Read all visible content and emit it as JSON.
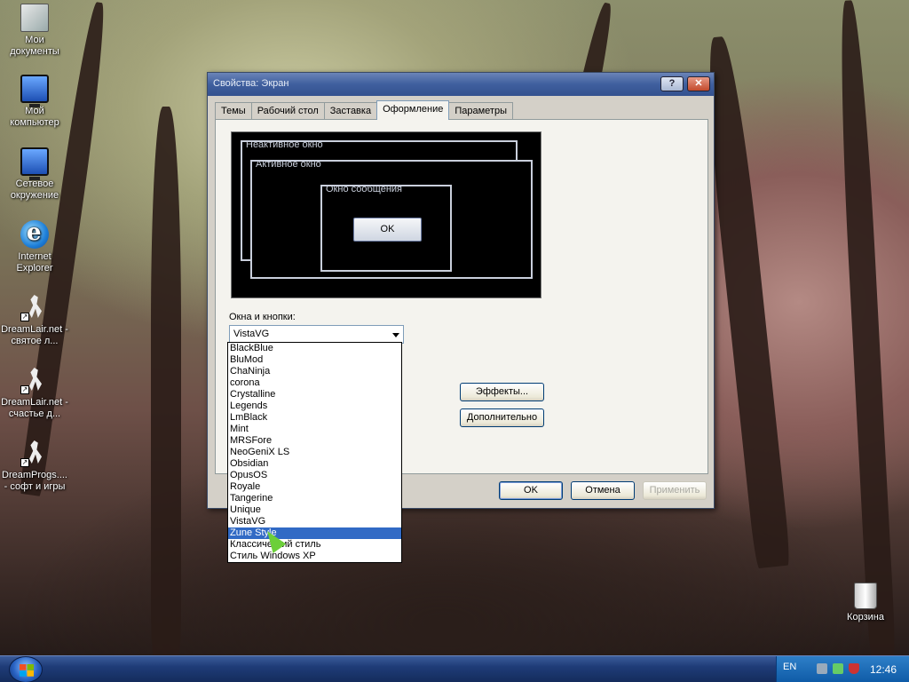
{
  "desktop": {
    "icons": [
      {
        "label": "Мои документы",
        "icon": "documents-icon"
      },
      {
        "label": "Мой компьютер",
        "icon": "computer-icon"
      },
      {
        "label": "Сетевое окружение",
        "icon": "network-icon"
      },
      {
        "label": "Internet Explorer",
        "icon": "internet-explorer-icon"
      },
      {
        "label": "DreamLair.net - святое л...",
        "icon": "shortcut-icon"
      },
      {
        "label": "DreamLair.net - счастье д...",
        "icon": "shortcut-icon"
      },
      {
        "label": "DreamProgs.... - софт и игры",
        "icon": "shortcut-icon"
      }
    ],
    "recycle_bin": {
      "label": "Корзина",
      "icon": "recycle-bin-icon"
    }
  },
  "dialog": {
    "title": "Свойства: Экран",
    "help_label": "?",
    "close_label": "✕",
    "tabs": [
      {
        "label": "Темы",
        "active": false
      },
      {
        "label": "Рабочий стол",
        "active": false
      },
      {
        "label": "Заставка",
        "active": false
      },
      {
        "label": "Оформление",
        "active": true
      },
      {
        "label": "Параметры",
        "active": false
      }
    ],
    "preview": {
      "inactive_window": "Неактивное окно",
      "active_window": "Активное окно",
      "message_window": "Окно сообщения",
      "ok": "OK"
    },
    "windows_buttons_label": "Окна и кнопки:",
    "windows_buttons_value": "VistaVG",
    "options": [
      "BlackBlue",
      "BluMod",
      "ChaNinja",
      "corona",
      "Crystalline",
      "Legends",
      "LmBlack",
      "Mint",
      "MRSFore",
      "NeoGeniX LS",
      "Obsidian",
      "OpusOS",
      "Royale",
      "Tangerine",
      "Unique",
      "VistaVG",
      "Zune Style",
      "Классический стиль",
      "Стиль Windows XP"
    ],
    "highlighted_option": "Zune Style",
    "effects_button": "Эффекты...",
    "advanced_button": "Дополнительно",
    "ok_button": "OK",
    "cancel_button": "Отмена",
    "apply_button": "Применить"
  },
  "taskbar": {
    "language": "EN",
    "clock": "12:46"
  },
  "colors": {
    "titlebar": "#3f5f9e",
    "selection": "#316ac5",
    "taskbar": "#1f3c78"
  }
}
